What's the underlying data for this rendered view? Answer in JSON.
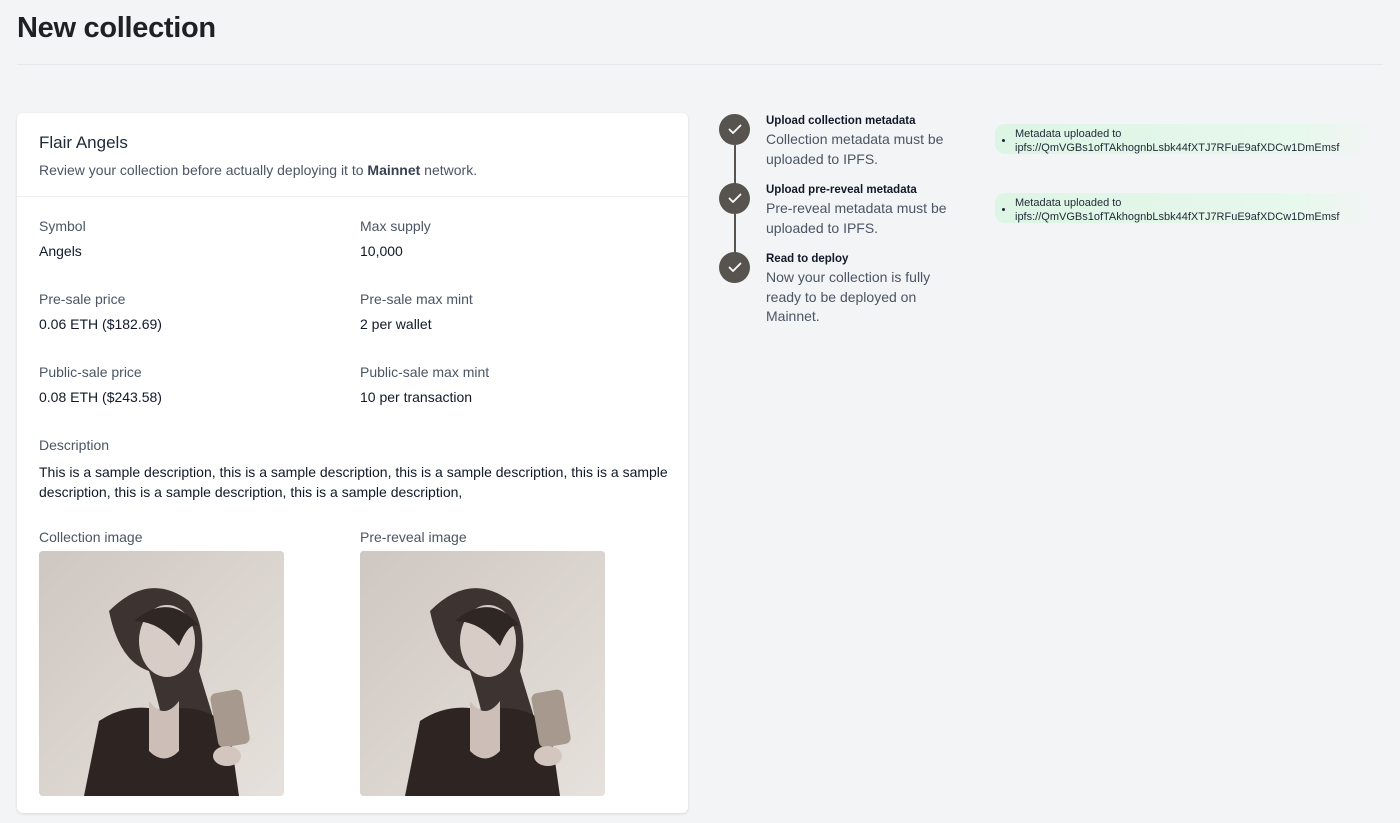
{
  "page": {
    "title": "New collection"
  },
  "card": {
    "title": "Flair Angels",
    "subtitle_before": "Review your collection before actually deploying it to ",
    "subtitle_network": "Mainnet",
    "subtitle_after": " network.",
    "symbol_label": "Symbol",
    "symbol_value": "Angels",
    "max_supply_label": "Max supply",
    "max_supply_value": "10,000",
    "presale_price_label": "Pre-sale price",
    "presale_price_value": "0.06 ETH ($182.69)",
    "presale_max_label": "Pre-sale max mint",
    "presale_max_value": "2 per wallet",
    "public_price_label": "Public-sale price",
    "public_price_value": "0.08 ETH ($243.58)",
    "public_max_label": "Public-sale max mint",
    "public_max_value": "10 per transaction",
    "description_label": "Description",
    "description_value": "This is a sample description, this is a sample description, this is a sample description, this is a sample description, this is a sample description, this is a sample description,",
    "collection_image_label": "Collection image",
    "prereveal_image_label": "Pre-reveal image"
  },
  "steps": [
    {
      "title": "Upload collection metadata",
      "desc": "Collection metadata must be uploaded to IPFS.",
      "status_icon": "check-icon"
    },
    {
      "title": "Upload pre-reveal metadata",
      "desc": "Pre-reveal metadata must be uploaded to IPFS.",
      "status_icon": "check-icon"
    },
    {
      "title": "Read to deploy",
      "desc": "Now your collection is fully ready to be deployed on Mainnet.",
      "status_icon": "check-icon"
    }
  ],
  "notes": [
    {
      "line1": "Metadata uploaded to",
      "line2": "ipfs://QmVGBs1ofTAkhognbLsbk44fXTJ7RFuE9afXDCw1DmEmsf"
    },
    {
      "line1": "Metadata uploaded to",
      "line2": "ipfs://QmVGBs1ofTAkhognbLsbk44fXTJ7RFuE9afXDCw1DmEmsf"
    }
  ],
  "colors": {
    "background": "#f3f4f6",
    "step_circle": "#57534e",
    "note_bg": "#dcf5e4"
  }
}
